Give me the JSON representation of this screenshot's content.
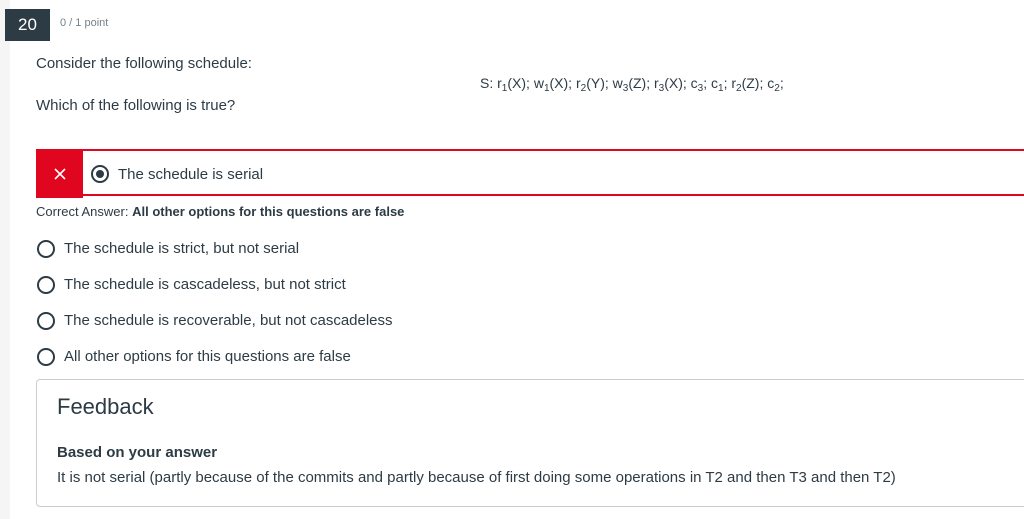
{
  "question": {
    "number": "20",
    "points": "0 / 1 point",
    "prompt": "Consider the following schedule:",
    "ask": "Which of the following is true?",
    "schedule": {
      "prefix": "S: ",
      "ops": [
        {
          "op": "r",
          "sub": "1",
          "arg": "(X)"
        },
        {
          "op": "w",
          "sub": "1",
          "arg": "(X)"
        },
        {
          "op": "r",
          "sub": "2",
          "arg": "(Y)"
        },
        {
          "op": "w",
          "sub": "3",
          "arg": "(Z)"
        },
        {
          "op": "r",
          "sub": "3",
          "arg": "(X)"
        },
        {
          "op": "c",
          "sub": "3",
          "arg": ""
        },
        {
          "op": "c",
          "sub": "1",
          "arg": ""
        },
        {
          "op": "r",
          "sub": "2",
          "arg": "(Z)"
        },
        {
          "op": "c",
          "sub": "2",
          "arg": ""
        }
      ],
      "separator": "; "
    }
  },
  "selected_answer": {
    "label": "The schedule is serial",
    "status_icon": "x-icon",
    "status_color": "#e0061f"
  },
  "correct_answer": {
    "prefix": "Correct Answer: ",
    "value": "All other options for this questions are false"
  },
  "options": [
    "The schedule is strict, but not serial",
    "The schedule is cascadeless, but not strict",
    "The schedule is recoverable, but not cascadeless",
    "All other options for this questions are false"
  ],
  "feedback": {
    "title": "Feedback",
    "subtitle": "Based on your answer",
    "text": "It is not serial (partly because of the commits and partly because of first doing some operations in T2 and then T3 and then T2)"
  }
}
